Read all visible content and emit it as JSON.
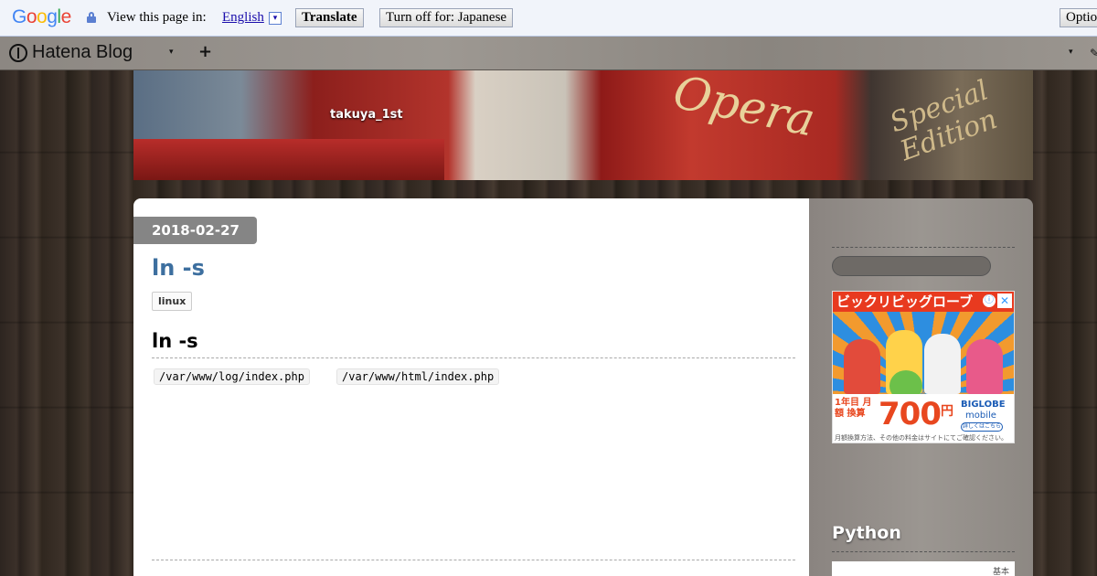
{
  "translate_bar": {
    "logo": "Google",
    "prompt": "View this page in:",
    "language": "English",
    "dropdown_glyph": "▾",
    "translate_label": "Translate",
    "turn_off_label": "Turn off for: Japanese",
    "options_label": "Options"
  },
  "hatena_bar": {
    "logo": "Hatena Blog",
    "caret": "▾",
    "plus": "+",
    "right_caret": "▾"
  },
  "header": {
    "blog_title": "takuya_1st",
    "banner_text_1": "Opera",
    "banner_text_2": "Special Edition"
  },
  "entry": {
    "date": "2018-02-27",
    "title": "ln -s",
    "category": "linux",
    "heading": "ln -s",
    "code": [
      "/var/www/log/index.php",
      "/var/www/html/index.php"
    ]
  },
  "sidebar": {
    "ad": {
      "headline": "ビックリビッグローブ",
      "info": "ⓘ",
      "close": "✕",
      "left_copy": "1年目 月額 換算",
      "price": "700",
      "yen": "円",
      "brand": "BIGLOBE",
      "brand_sub": "mobile",
      "link": "詳しくはこちら",
      "fine_print": "月額換算方法、その他の料金はサイトにてご確認ください。"
    },
    "heading": "Python",
    "widget_text": "基本"
  },
  "colors": {
    "title_blue": "#3d6f9f",
    "badge_gray": "#858585",
    "ad_red": "#e83a1f"
  }
}
